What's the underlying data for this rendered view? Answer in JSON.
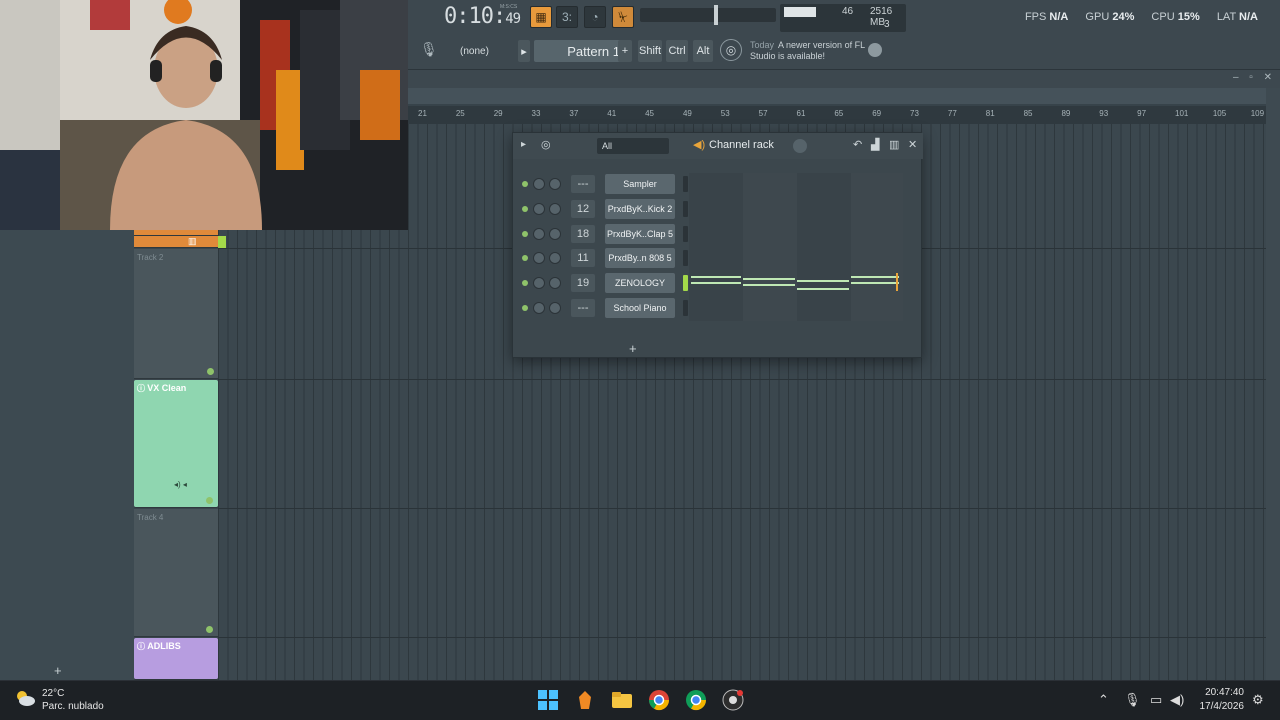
{
  "transport": {
    "time_main": "0:10:",
    "time_small": "49",
    "time_unit": "M:S:CS",
    "pattern_label": "Pattern 1",
    "midi_input": "(none)",
    "cpu_monitor_value": "46",
    "memory": "2516 MB",
    "polyphony": "3"
  },
  "stats": {
    "fps_label": "FPS",
    "fps_value": "N/A",
    "gpu_label": "GPU",
    "gpu_value": "24%",
    "cpu_label": "CPU",
    "cpu_value": "15%",
    "lat_label": "LAT",
    "lat_value": "N/A"
  },
  "keys": {
    "shift": "Shift",
    "ctrl": "Ctrl",
    "alt": "Alt"
  },
  "hint": {
    "prefix": "Today",
    "message": "A newer version of FL Studio is available!"
  },
  "ruler": [
    "21",
    "25",
    "29",
    "33",
    "37",
    "41",
    "45",
    "49",
    "53",
    "57",
    "61",
    "65",
    "69",
    "73",
    "77",
    "81",
    "85",
    "89",
    "93",
    "97",
    "101",
    "105",
    "109"
  ],
  "tracks": [
    {
      "label": "Track 2"
    },
    {
      "name": "VX Clean",
      "color": "#8fd6b0"
    },
    {
      "label": "Track 4"
    },
    {
      "name": "ADLIBS",
      "color": "#b79de0"
    }
  ],
  "channel_rack": {
    "title": "Channel rack",
    "filter": "All",
    "add": "+",
    "channels": [
      {
        "num": "---",
        "name": "Sampler"
      },
      {
        "num": "12",
        "name": "PrxdByK..Kick 2"
      },
      {
        "num": "18",
        "name": "PrxdByK..Clap 5"
      },
      {
        "num": "11",
        "name": "PrxdBy..n 808 5"
      },
      {
        "num": "19",
        "name": "ZENOLOGY"
      },
      {
        "num": "---",
        "name": "School Piano"
      }
    ]
  },
  "taskbar": {
    "temp": "22°C",
    "weather": "Parc. nublado",
    "time": "20:47:40",
    "date": "17/4/2026"
  },
  "playlist_add": "+"
}
